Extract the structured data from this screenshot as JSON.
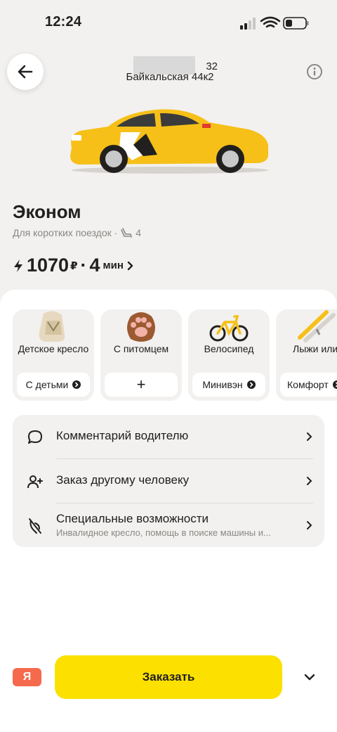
{
  "status_bar": {
    "time": "12:24"
  },
  "header": {
    "from_address_visible": "32",
    "to_address": "Байкальская 44к2"
  },
  "tariff": {
    "title": "Эконом",
    "subtitle": "Для коротких поездок ·",
    "seats": "4",
    "price": "1070",
    "currency": "₽",
    "separator": "·",
    "eta_value": "4",
    "eta_unit": "мин"
  },
  "options": [
    {
      "label": "Детское кресло",
      "button": "С детьми"
    },
    {
      "label": "С питомцем",
      "button": "+"
    },
    {
      "label": "Велосипед",
      "button": "Минивэн"
    },
    {
      "label": "Лыжи или сноуборд",
      "button": "Комфорт"
    }
  ],
  "menu": {
    "comment": "Комментарий водителю",
    "order_for_other": "Заказ другому человеку",
    "accessibility": "Специальные возможности",
    "accessibility_sub": "Инвалидное кресло, помощь в поиске машины и..."
  },
  "bottom": {
    "pay_badge": "Я",
    "order_button": "Заказать"
  },
  "colors": {
    "accent_yellow": "#fce000",
    "pay_red": "#f56a4d",
    "surface_gray": "#f2f1ef"
  }
}
